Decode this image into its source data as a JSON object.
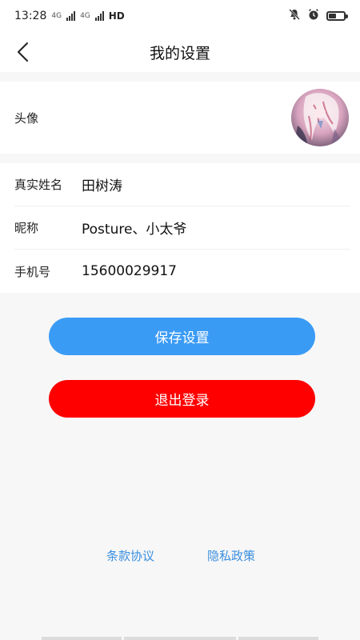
{
  "status_bar": {
    "time": "13:28",
    "network_1": "4G",
    "network_2": "4G",
    "hd": "HD",
    "battery_level": 0.5
  },
  "nav": {
    "title": "我的设置"
  },
  "profile": {
    "avatar_label": "头像",
    "fields": [
      {
        "label": "真实姓名",
        "value": "田树涛"
      },
      {
        "label": "昵称",
        "value": "Posture、小太爷"
      },
      {
        "label": "手机号",
        "value": "15600029917"
      }
    ]
  },
  "actions": {
    "save_label": "保存设置",
    "logout_label": "退出登录"
  },
  "footer": {
    "terms_label": "条款协议",
    "privacy_label": "隐私政策"
  },
  "colors": {
    "save_button": "#3a9bf5",
    "logout_button": "#ff0000",
    "link": "#3a8fe0"
  },
  "icons": {
    "back": "chevron-left-icon",
    "mute": "bell-off-icon",
    "alarm": "alarm-clock-icon",
    "battery": "battery-icon"
  }
}
